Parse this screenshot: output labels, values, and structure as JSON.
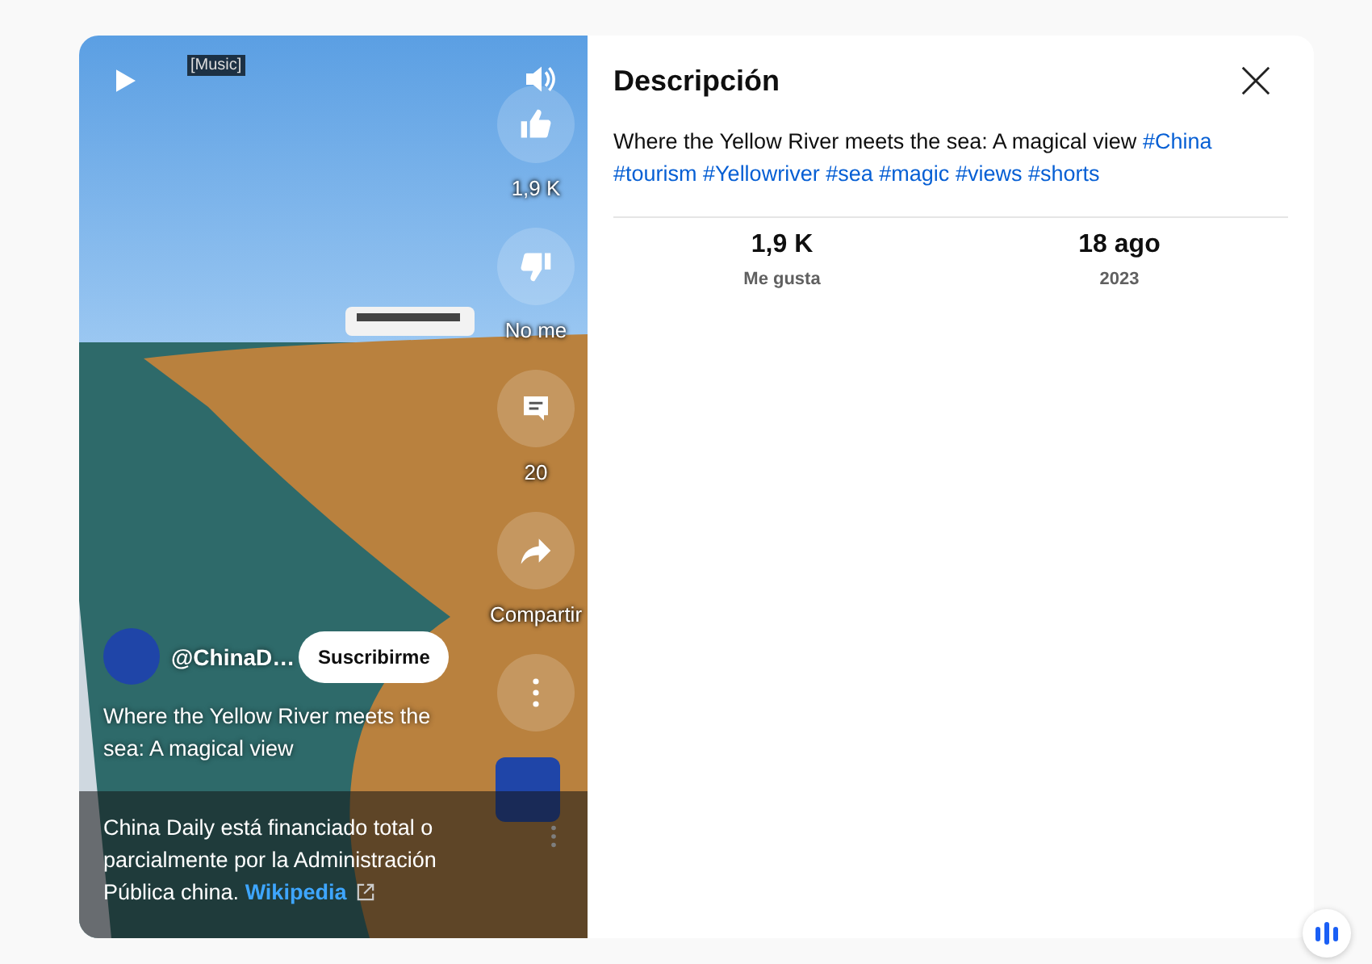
{
  "player": {
    "caption": "[Music]",
    "actions": [
      {
        "kind": "like",
        "label": "1,9 K"
      },
      {
        "kind": "dislike",
        "label": "No me"
      },
      {
        "kind": "comment",
        "label": "20"
      },
      {
        "kind": "share",
        "label": "Compartir"
      },
      {
        "kind": "more"
      }
    ],
    "channel": {
      "handle": "@ChinaD…",
      "subscribe": "Suscribirme"
    },
    "title": "Where the Yellow River meets the sea: A magical view",
    "notice": {
      "text": "China Daily está financiado total o parcialmente por la Administración Pública china.",
      "link": "Wikipedia"
    }
  },
  "description": {
    "heading": "Descripción",
    "text": "Where the Yellow River meets the sea: A magical view",
    "hashtags": [
      "#China",
      "#tourism",
      "#Yellowriver",
      "#sea",
      "#magic",
      "#views",
      "#shorts"
    ],
    "stats": [
      {
        "value": "1,9 K",
        "label": "Me gusta"
      },
      {
        "value": "18 ago",
        "label": "2023"
      }
    ]
  }
}
